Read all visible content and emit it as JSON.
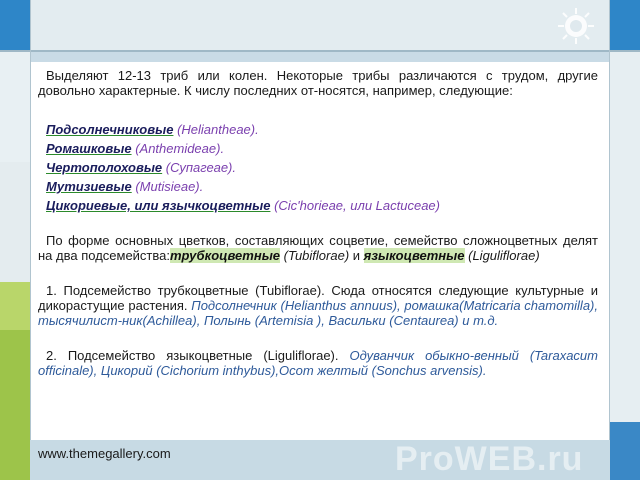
{
  "footer": {
    "site": "www.themegallery.com",
    "watermark": "ProWEB.ru"
  },
  "intro": "Выделяют 12-13 триб или колен. Некоторые трибы различаются с трудом, другие довольно характерные. К числу  последних от-носятся, например, следующие:",
  "tribes": [
    {
      "name": "Подсолнечниковые",
      "latin": "(Heliantheae)."
    },
    {
      "name": "Ромашковые",
      "latin": "(Anthemideae)."
    },
    {
      "name": "Чертополоховые",
      "latin": "(Супагеае)."
    },
    {
      "name": "Мутизиевые",
      "latin": "(Mutisieae)."
    },
    {
      "name": "Цикориевые, или язычкоцветные",
      "latin": "(Cic'horieae, или Lactuceae)"
    }
  ],
  "division": {
    "text": "По форме основных цветков, составляющих соцветие, семейство сложноцветных делят на два подсемейства:",
    "sub1": "трубкоцветные",
    "sub1_latin": "   (Tubiflorae)",
    "and": "и",
    "sub2": "языкоцветные",
    "sub2_latin": "(Liguliflorae)"
  },
  "para1": {
    "text": "1. Подсемейство трубкоцветные (Tubiflorae). Сюда относятся     следующие культурные и дикорастущие растения.",
    "examples": " Подсолнечник  (Helianthus annuus), ромашка(Matricaria chamomilla), тысячилист-ник(Achillea), Полынь (Artemisia ), Васильки (Centaurea) и т.д."
  },
  "para2": {
    "text": "2. Подсемейство языкоцветные (Liguliflorae).",
    "examples": " Одуванчик обыкно-венный (Taraxacum officinale), Цикорий (Cichorium  inthybus),Осот желтый (Sonchus arvensis)."
  }
}
